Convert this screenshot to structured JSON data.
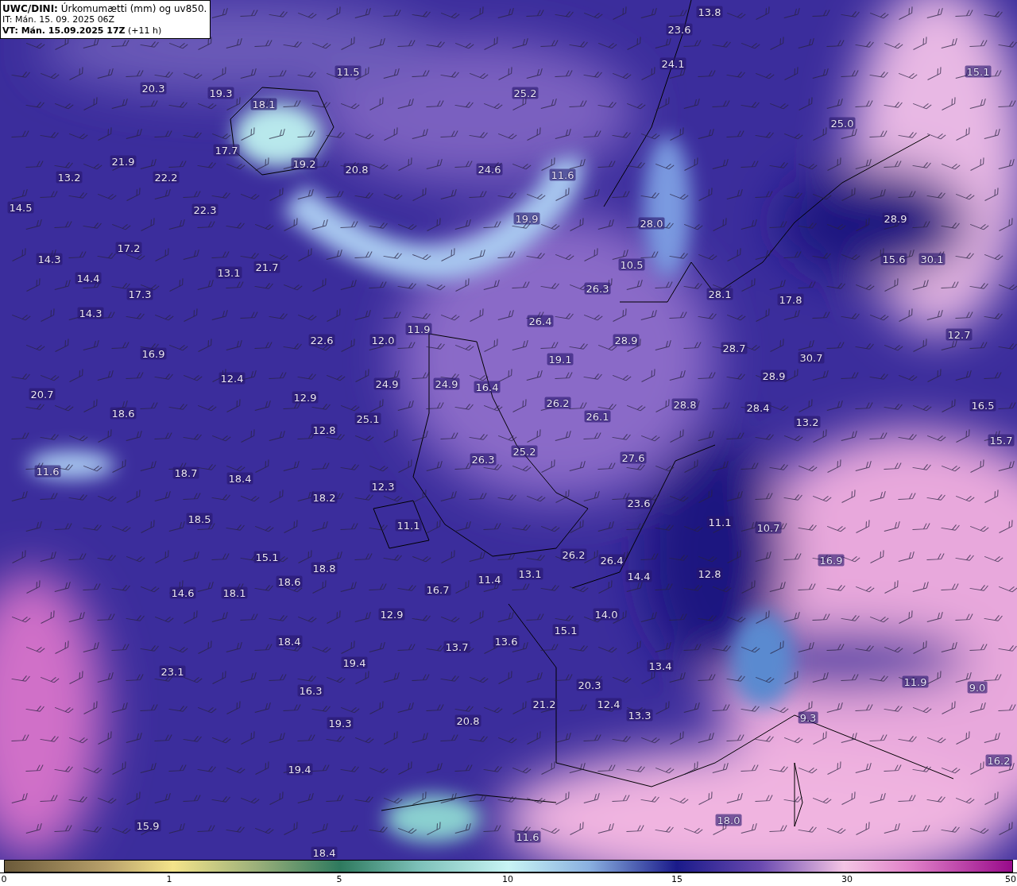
{
  "title_box": {
    "lines": [
      "**UWC/DINI:** Úrkomumætti (mm) og uv850.",
      "IT: Mán. 15. 09. 2025 06Z",
      "**VT: Mán. 15.09.2025 17Z** (+11 h)"
    ]
  },
  "map": {
    "labels": [
      "13.8",
      "23.6",
      "11.5",
      "24.1",
      "15.1",
      "20.3",
      "19.3",
      "18.1",
      "25.2",
      "25.0",
      "17.7",
      "19.2",
      "21.9",
      "13.2",
      "22.2",
      "20.8",
      "24.6",
      "11.6",
      "14.5",
      "22.3",
      "19.9",
      "28.0",
      "28.9",
      "14.3",
      "17.2",
      "21.7",
      "13.1",
      "15.6",
      "30.1",
      "14.4",
      "17.3",
      "10.5",
      "26.3",
      "28.1",
      "17.8",
      "14.3",
      "26.4",
      "11.9",
      "12.7",
      "22.6",
      "12.0",
      "28.9",
      "16.9",
      "19.1",
      "28.7",
      "30.7",
      "12.4",
      "28.9",
      "24.9",
      "24.9",
      "16.4",
      "20.7",
      "26.2",
      "26.1",
      "28.8",
      "28.4",
      "13.2",
      "18.6",
      "12.9",
      "25.1",
      "16.5",
      "12.8",
      "15.7",
      "26.3",
      "25.2",
      "27.6",
      "11.6",
      "18.7",
      "18.4",
      "12.3",
      "18.2",
      "23.6",
      "18.5",
      "11.1",
      "11.1",
      "10.7",
      "15.1",
      "18.8",
      "26.2",
      "26.4",
      "16.9",
      "13.1",
      "11.4",
      "14.4",
      "12.8",
      "14.6",
      "18.1",
      "18.6",
      "16.7",
      "14.0",
      "12.9",
      "15.1",
      "18.4",
      "13.7",
      "13.6",
      "19.4",
      "13.4",
      "23.1",
      "11.9",
      "9.0",
      "16.3",
      "20.3",
      "21.2",
      "12.4",
      "13.3",
      "19.3",
      "20.8",
      "9.3",
      "16.2",
      "19.4",
      "15.9",
      "11.6",
      "18.0",
      "18.4"
    ]
  },
  "colorbar": {
    "ticks": [
      "0",
      "1",
      "5",
      "10",
      "15",
      "30",
      "50"
    ]
  }
}
